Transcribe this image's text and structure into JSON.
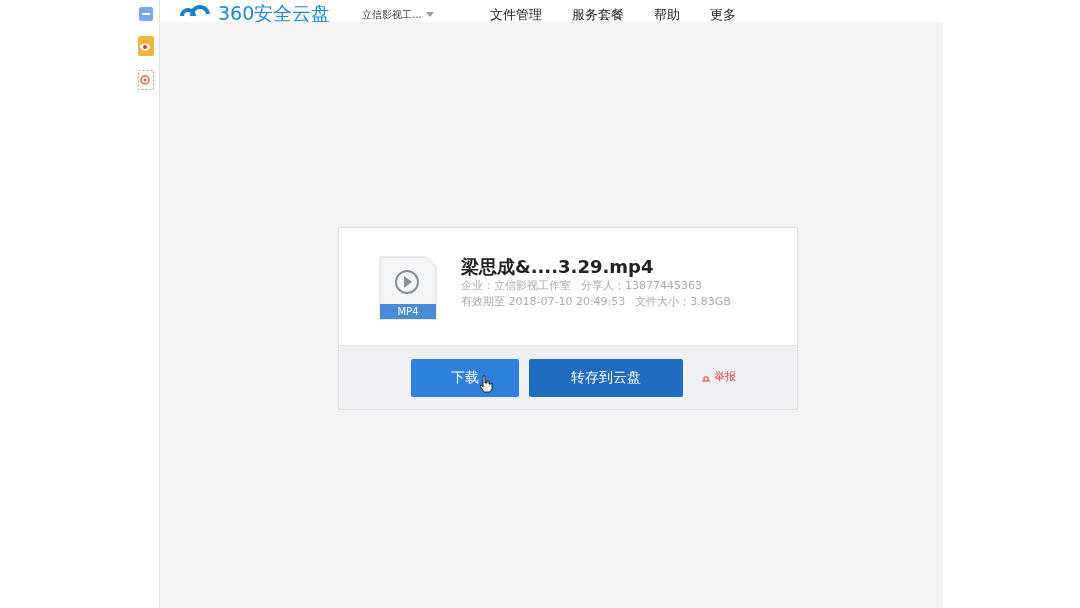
{
  "header": {
    "logo": "360安全云盘",
    "account": "立信影视工...",
    "nav": [
      "文件管理",
      "服务套餐",
      "帮助",
      "更多"
    ]
  },
  "file": {
    "type_label": "MP4",
    "name": "梁思成&....3.29.mp4",
    "company": "企业：立信影视工作室",
    "sharer": "分享人：13877445363",
    "expiry": "有效期至 2018-07-10 20:49:53",
    "size": "文件大小：3.83GB"
  },
  "actions": [
    {
      "label": "下载",
      "kind": "primary"
    },
    {
      "label": "转存到云盘",
      "kind": "save"
    }
  ],
  "report": "举报"
}
